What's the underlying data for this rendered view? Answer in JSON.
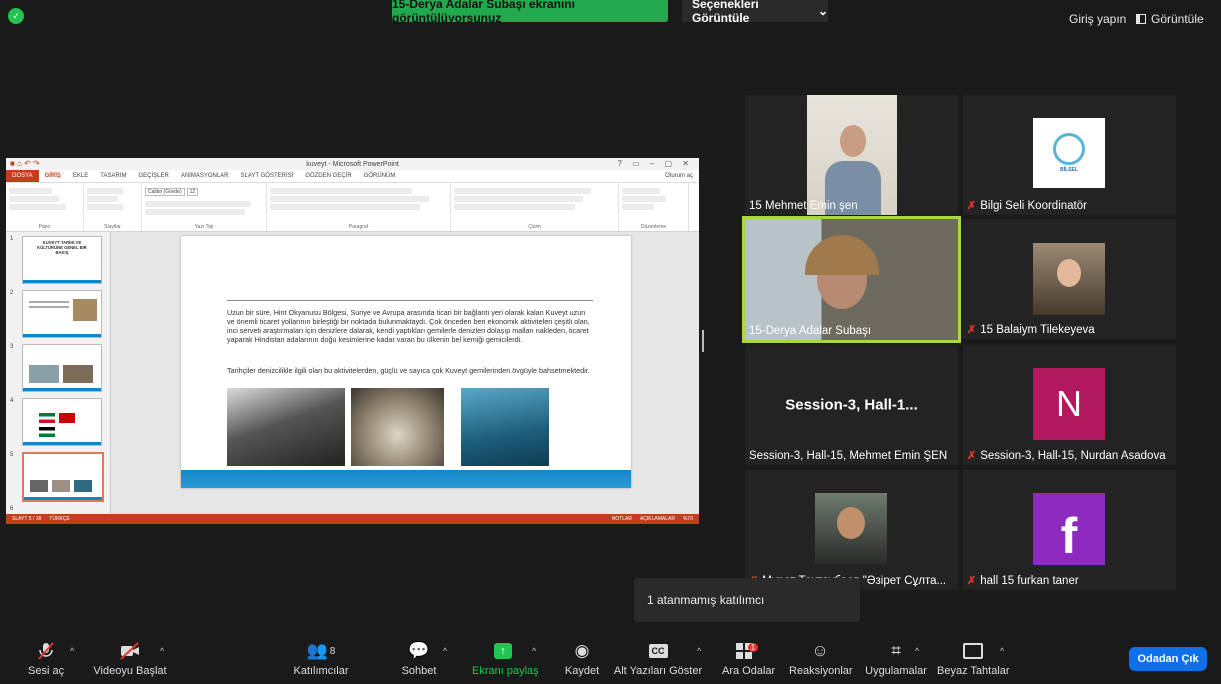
{
  "top": {
    "share_banner": "15-Derya Adalar Subaşı ekranını görüntülüyorsunuz",
    "view_options": "Seçenekleri Görüntüle",
    "signin": "Giriş yapın",
    "view": "Görüntüle"
  },
  "ppt": {
    "window_title": "kuveyt - Microsoft PowerPoint",
    "tabs": [
      "DOSYA",
      "GİRİŞ",
      "EKLE",
      "TASARIM",
      "GEÇİŞLER",
      "ANİMASYONLAR",
      "SLAYT GÖSTERİSİ",
      "GÖZDEN GEÇİR",
      "GÖRÜNÜM"
    ],
    "user": "Oturum aç",
    "groups": [
      "Pano",
      "Slaytlar",
      "Yazı Tipi",
      "Paragraf",
      "Çizim",
      "Düzenleme"
    ],
    "font_name": "Calibri (Gövde)",
    "font_size": "12",
    "thumb1_title": "KUVEYT TARİHİ VE KÜLTÜRÜNE GENEL BİR BAKIŞ",
    "thumb_numbers": [
      "1",
      "2",
      "3",
      "4",
      "5",
      "6"
    ],
    "slide_para1": "Uzun bir süre, Hint Okyanusu Bölgesi, Suriye ve Avrupa arasında ticari bir bağlantı yeri olarak kalan Kuveyt uzun ve önemli ticaret yollarının birleştiği bir noktada bulunmaktaydı. Çok önceden beri ekonomik aktiviteleri çeşitli olan, inci serveti araştırmaları için denizlere dalarak, kendi yaptıkları gemilerle denizleri dolaşıp malları nakleden, ticaret yaparak Hindistan adalarının doğu kesimlerine kadar varan bu ülkenin bel kemiği gemicilerdi.",
    "slide_para2": "Tarihçiler denizcilikle ilgili olan bu aktivitelerden, güçlü ve sayıca çok Kuveyt gemilerinden övgüyle bahsetmektedir.",
    "status_left": "SLAYT 5 / 18",
    "status_lang": "TÜRKÇE",
    "status_notes": "NOTLAR",
    "status_comments": "AÇIKLAMALAR",
    "zoom": "%70"
  },
  "tiles": [
    {
      "name": "15 Mehmet Emin şen",
      "muted": false
    },
    {
      "name": "Bilgi Seli Koordinatör",
      "muted": true
    },
    {
      "name": "15-Derya Adalar Subaşı",
      "muted": false
    },
    {
      "name": "15 Balaiym Tilekeyeva",
      "muted": true
    },
    {
      "name": "Session-3, Hall-15, Mehmet Emin ŞEN",
      "center": "Session-3,  Hall-1...",
      "muted": false
    },
    {
      "name": "Session-3, Hall-15, Nurdan Asadova",
      "letter": "N",
      "muted": true
    },
    {
      "name": "Мурат Тахтаубаев \"Әзірет Сұлта...",
      "muted": true
    },
    {
      "name": "hall 15 furkan taner",
      "letter": "f",
      "muted": true
    }
  ],
  "logo_text": "BİLSEL",
  "tooltip": "1 atanmamış katılımcı",
  "toolbar": {
    "mic": "Sesi aç",
    "video": "Videoyu Başlat",
    "participants": "Katılımcılar",
    "participants_count": "8",
    "chat": "Sohbet",
    "share": "Ekranı paylaş",
    "record": "Kaydet",
    "captions": "Alt Yazıları Göster",
    "breakout": "Ara Odalar",
    "breakout_badge": "1",
    "reactions": "Reaksiyonlar",
    "apps": "Uygulamalar",
    "whiteboard": "Beyaz Tahtalar",
    "leave": "Odadan Çık"
  },
  "colors": {
    "share_green": "#23a94d",
    "leave_blue": "#0e71eb",
    "active_speaker": "#a7d744",
    "mute_red": "#e0362c",
    "ppt_orange": "#c43e1c"
  }
}
